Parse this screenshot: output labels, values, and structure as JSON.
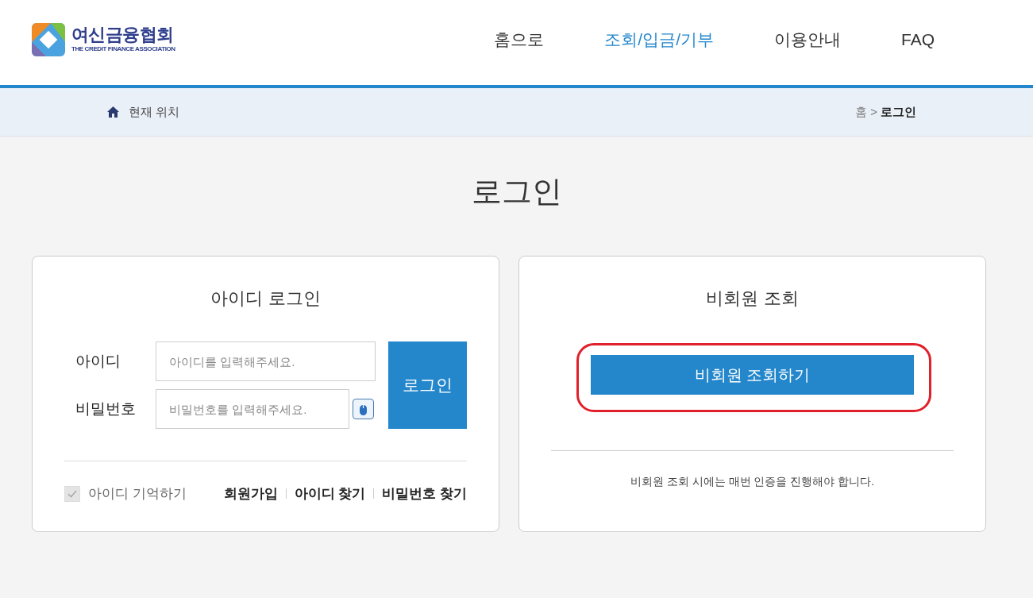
{
  "logo": {
    "name": "여신금융협회",
    "subtitle": "THE CREDIT FINANCE ASSOCIATION"
  },
  "nav": [
    {
      "label": "홈으로",
      "selected": false
    },
    {
      "label": "조회/입금/기부",
      "selected": true
    },
    {
      "label": "이용안내",
      "selected": false
    },
    {
      "label": "FAQ",
      "selected": false
    }
  ],
  "location": {
    "label": "현재 위치",
    "breadcrumb": [
      "홈",
      ">",
      "로그인"
    ]
  },
  "title": "로그인",
  "id_login": {
    "title": "아이디 로그인",
    "id_label": "아이디",
    "id_placeholder": "아이디를 입력해주세요.",
    "pw_label": "비밀번호",
    "pw_placeholder": "비밀번호를 입력해주세요.",
    "button": "로그인",
    "remember": {
      "label": "아이디 기억하기",
      "checked": true,
      "disabled": true
    },
    "links": [
      "회원가입",
      "아이디 찾기",
      "비밀번호 찾기"
    ]
  },
  "nonmember": {
    "title": "비회원 조회",
    "button": "비회원 조회하기",
    "highlighted": true,
    "note": "비회원 조회 시에는 매번 인증을 진행해야 합니다."
  }
}
